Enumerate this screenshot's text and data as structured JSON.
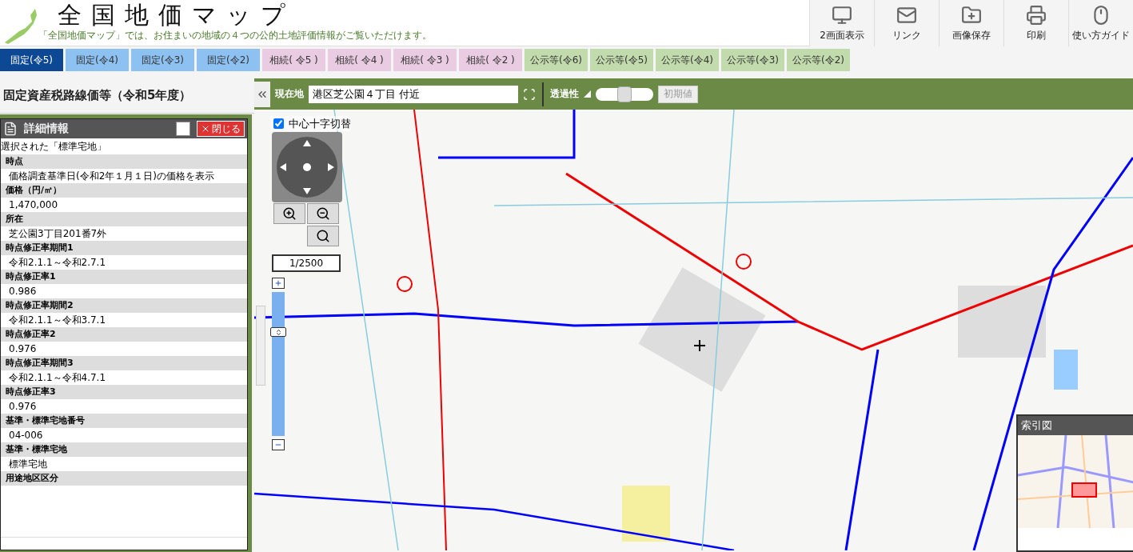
{
  "header": {
    "title": "全国地価マップ",
    "subtitle": "「全国地価マップ」では、お住まいの地域の４つの公的土地評価情報がご覧いただけます。"
  },
  "tools": [
    {
      "kind": "dual",
      "label": "2画面表示"
    },
    {
      "kind": "link",
      "label": "リンク"
    },
    {
      "kind": "save",
      "label": "画像保存"
    },
    {
      "kind": "print",
      "label": "印刷"
    },
    {
      "kind": "guide",
      "label": "使い方ガイド"
    }
  ],
  "tabs": [
    {
      "kind": "fixed",
      "label": "固定(令5)",
      "selected": true
    },
    {
      "kind": "fixed",
      "label": "固定(令4)",
      "selected": false
    },
    {
      "kind": "fixed",
      "label": "固定(令3)",
      "selected": false
    },
    {
      "kind": "fixed",
      "label": "固定(令2)",
      "selected": false
    },
    {
      "kind": "inherit",
      "label": "相続( 令5 )",
      "selected": false
    },
    {
      "kind": "inherit",
      "label": "相続( 令4 )",
      "selected": false
    },
    {
      "kind": "inherit",
      "label": "相続( 令3 )",
      "selected": false
    },
    {
      "kind": "inherit",
      "label": "相続( 令2 )",
      "selected": false
    },
    {
      "kind": "public",
      "label": "公示等(令6)",
      "selected": false
    },
    {
      "kind": "public",
      "label": "公示等(令5)",
      "selected": false
    },
    {
      "kind": "public",
      "label": "公示等(令4)",
      "selected": false
    },
    {
      "kind": "public",
      "label": "公示等(令3)",
      "selected": false
    },
    {
      "kind": "public",
      "label": "公示等(令2)",
      "selected": false
    }
  ],
  "sidebar": {
    "title": "固定資産税路線価等（令和5年度）",
    "detail": {
      "title": "詳細情報",
      "close": "閉じる",
      "intro": "選択された「標準宅地」",
      "fields": [
        {
          "label": "時点",
          "value": "価格調査基準日(令和2年１月１日)の価格を表示"
        },
        {
          "label": "価格（円/㎡）",
          "value": "1,470,000"
        },
        {
          "label": "所在",
          "value": "芝公園3丁目201番7外"
        },
        {
          "label": "時点修正率期間1",
          "value": "令和2.1.1～令和2.7.1"
        },
        {
          "label": "時点修正率1",
          "value": "0.986"
        },
        {
          "label": "時点修正率期間2",
          "value": "令和2.1.1～令和3.7.1"
        },
        {
          "label": "時点修正率2",
          "value": "0.976"
        },
        {
          "label": "時点修正率期間3",
          "value": "令和2.1.1～令和4.7.1"
        },
        {
          "label": "時点修正率3",
          "value": "0.976"
        },
        {
          "label": "基準・標準宅地番号",
          "value": "04-006"
        },
        {
          "label": "基準・標準宅地",
          "value": "標準宅地"
        },
        {
          "label": "用途地区区分"
        }
      ]
    }
  },
  "map_toolbar": {
    "location_label": "現在地",
    "location": "港区芝公園４丁目 付近",
    "opacity_label": "透過性",
    "opacity": {
      "level": 0.5
    },
    "reset": "初期値"
  },
  "map": {
    "crosshair": {
      "label": "中心十字切替",
      "checked": true
    },
    "scale": "1/2500",
    "zoom": {
      "level": 0.72
    },
    "index_map": {
      "title": "索引図"
    }
  }
}
